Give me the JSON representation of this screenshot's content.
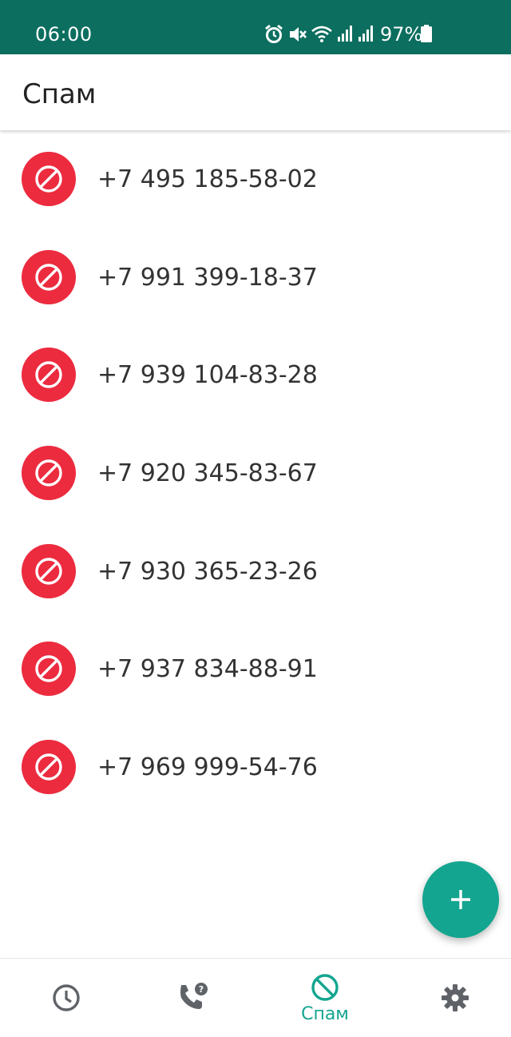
{
  "status_bar": {
    "time": "06:00",
    "battery_percent": "97%",
    "icons": [
      "alarm-icon",
      "mute-icon",
      "wifi-icon",
      "signal-icon",
      "signal-icon",
      "battery-icon"
    ]
  },
  "app_bar": {
    "title": "Спам"
  },
  "spam_list": [
    {
      "number": "+7 495 185-58-02",
      "icon": "block-icon"
    },
    {
      "number": "+7 991 399-18-37",
      "icon": "block-icon"
    },
    {
      "number": "+7 939 104-83-28",
      "icon": "block-icon"
    },
    {
      "number": "+7 920 345-83-67",
      "icon": "block-icon"
    },
    {
      "number": "+7 930 365-23-26",
      "icon": "block-icon"
    },
    {
      "number": "+7 937 834-88-91",
      "icon": "block-icon"
    },
    {
      "number": "+7 969 999-54-76",
      "icon": "block-icon"
    }
  ],
  "fab": {
    "icon": "plus-icon"
  },
  "bottom_nav": {
    "items": [
      {
        "icon": "clock-icon",
        "label": ""
      },
      {
        "icon": "phone-question-icon",
        "label": ""
      },
      {
        "icon": "block-icon",
        "label": "Спам",
        "active": true
      },
      {
        "icon": "gear-icon",
        "label": ""
      }
    ]
  },
  "colors": {
    "status_bar": "#0b6e5f",
    "accent": "#13a58f",
    "block_red": "#ec2b3f",
    "inactive_icon": "#5f6368"
  }
}
